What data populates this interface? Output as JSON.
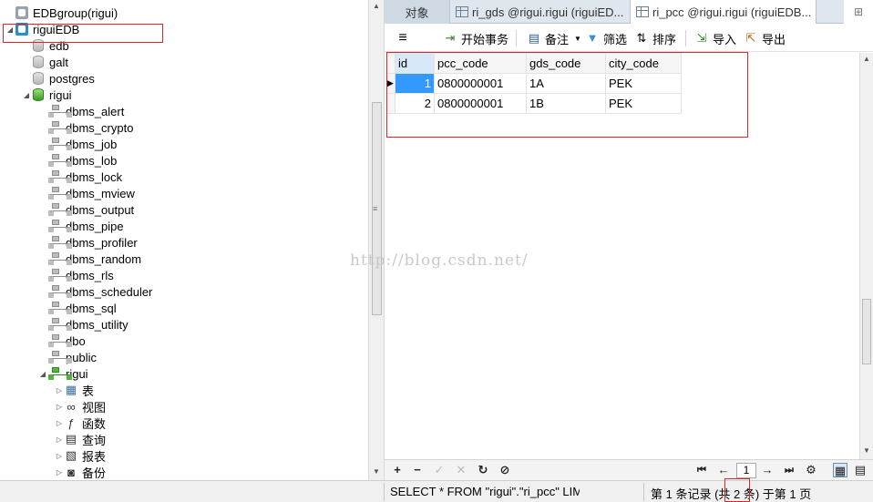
{
  "tree": {
    "top_partial_label": "",
    "items": [
      {
        "label": "EDBgroup(rigui)",
        "icon": "server-icon",
        "level": 0
      },
      {
        "label": "riguiEDB",
        "icon": "server-icon",
        "level": 0,
        "expanded": true
      },
      {
        "label": "edb",
        "icon": "database-icon",
        "level": 1
      },
      {
        "label": "galt",
        "icon": "database-icon",
        "level": 1
      },
      {
        "label": "postgres",
        "icon": "database-icon",
        "level": 1
      },
      {
        "label": "rigui",
        "icon": "database-icon",
        "level": 1,
        "expanded": true
      },
      {
        "label": "dbms_alert",
        "icon": "schema-icon",
        "level": 2
      },
      {
        "label": "dbms_crypto",
        "icon": "schema-icon",
        "level": 2
      },
      {
        "label": "dbms_job",
        "icon": "schema-icon",
        "level": 2
      },
      {
        "label": "dbms_lob",
        "icon": "schema-icon",
        "level": 2
      },
      {
        "label": "dbms_lock",
        "icon": "schema-icon",
        "level": 2
      },
      {
        "label": "dbms_mview",
        "icon": "schema-icon",
        "level": 2
      },
      {
        "label": "dbms_output",
        "icon": "schema-icon",
        "level": 2
      },
      {
        "label": "dbms_pipe",
        "icon": "schema-icon",
        "level": 2
      },
      {
        "label": "dbms_profiler",
        "icon": "schema-icon",
        "level": 2
      },
      {
        "label": "dbms_random",
        "icon": "schema-icon",
        "level": 2
      },
      {
        "label": "dbms_rls",
        "icon": "schema-icon",
        "level": 2
      },
      {
        "label": "dbms_scheduler",
        "icon": "schema-icon",
        "level": 2
      },
      {
        "label": "dbms_sql",
        "icon": "schema-icon",
        "level": 2
      },
      {
        "label": "dbms_utility",
        "icon": "schema-icon",
        "level": 2
      },
      {
        "label": "dbo",
        "icon": "schema-icon",
        "level": 2
      },
      {
        "label": "public",
        "icon": "schema-icon",
        "level": 2
      },
      {
        "label": "rigui",
        "icon": "schema-icon",
        "level": 2,
        "expanded": true
      },
      {
        "label": "表",
        "icon": "table-icon",
        "level": 3
      },
      {
        "label": "视图",
        "icon": "view-icon",
        "level": 3
      },
      {
        "label": "函数",
        "icon": "function-icon",
        "level": 3
      },
      {
        "label": "查询",
        "icon": "query-icon",
        "level": 3
      },
      {
        "label": "报表",
        "icon": "report-icon",
        "level": 3
      },
      {
        "label": "备份",
        "icon": "backup-icon",
        "level": 3
      }
    ]
  },
  "tabs": [
    {
      "label": "对象"
    },
    {
      "label": "ri_gds @rigui.rigui (riguiED..."
    },
    {
      "label": "ri_pcc @rigui.rigui (riguiEDB..."
    }
  ],
  "toolbar": {
    "begin_transaction": "开始事务",
    "memo": "备注",
    "filter": "筛选",
    "sort": "排序",
    "import": "导入",
    "export": "导出"
  },
  "grid": {
    "columns": [
      "id",
      "pcc_code",
      "gds_code",
      "city_code"
    ],
    "rows": [
      [
        "1",
        "0800000001",
        "1A",
        "PEK"
      ],
      [
        "2",
        "0800000001",
        "1B",
        "PEK"
      ]
    ]
  },
  "pager": {
    "page": "1"
  },
  "status": {
    "sql": "SELECT * FROM \"rigui\".\"ri_pcc\" LIMI",
    "record_info": "第 1 条记录 (共 2 条) 于第 1 页"
  },
  "watermark": "http://blog.csdn.net/",
  "colors": {
    "accent": "#3399ff",
    "highlight_box": "#d9262a"
  }
}
